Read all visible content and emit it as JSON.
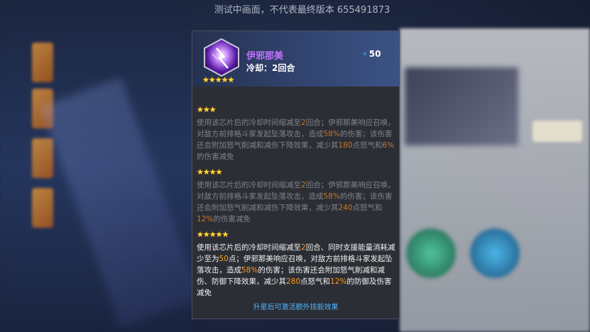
{
  "watermark": "测试中画面，不代表最终版本 655491873",
  "skill": {
    "name": "伊邪那美",
    "cooldown": "冷却：2回合",
    "energy_cost": "50",
    "star_rating": "★★★★★",
    "icon": "purple-thunder-skill-icon"
  },
  "tiers": [
    {
      "stars": "★★★",
      "line1_a": "使用该芯片后的冷却时间缩减至",
      "line1_hl": "2",
      "line1_b": "回合；伊邪那美响应召唤，对敌方前排格斗家发起坠落攻击，造成",
      "hl2": "58%",
      "mid": "的伤害；该伤害还会附加怒气削减和减伤下降效果，减少其",
      "hl3": "180",
      "mid2": "点怒气和",
      "hl4": "6%",
      "end": "的伤害减免"
    },
    {
      "stars": "★★★★",
      "line1_a": "使用该芯片后的冷却时间缩减至",
      "line1_hl": "2",
      "line1_b": "回合；伊邪那美响应召唤，对敌方前排格斗家发起坠落攻击，造成",
      "hl2": "58%",
      "mid": "的伤害；该伤害还会附加怒气削减和减伤下降效果，减少其",
      "hl3": "240",
      "mid2": "点怒气和",
      "hl4": "12%",
      "end": "的伤害减免"
    },
    {
      "stars": "★★★★★",
      "line1_a": "使用该芯片后的冷却时间缩减至",
      "line1_hl": "2",
      "line1_b": "回合、同时支援能量消耗减少至为",
      "hl_extra": "50",
      "extra_after": "点；伊邪那美响应召唤，对敌方前排格斗家发起坠落攻击，造成",
      "hl2": "58%",
      "mid": "的伤害；该伤害还会附加怒气削减和减伤、防御下降效果，减少其",
      "hl3": "280",
      "mid2": "点怒气和",
      "hl4": "12%",
      "end": "的防御及伤害减免"
    }
  ],
  "footer_note": "升星后可激活额外技能效果",
  "colors": {
    "panel_bg": "#2c2e35",
    "skill_name": "#c272ff",
    "highlight": "#ff9a20",
    "footer": "#4fb5ff",
    "stars": "#ffd840"
  }
}
